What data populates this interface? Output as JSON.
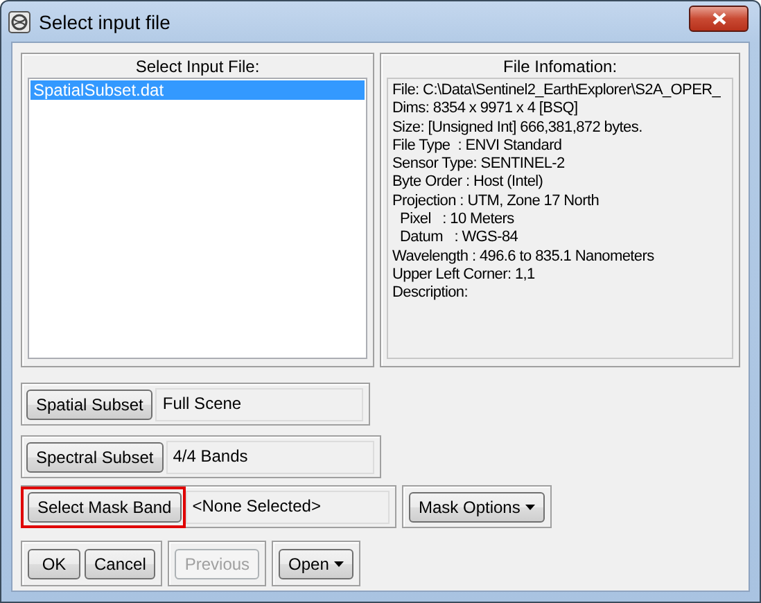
{
  "window": {
    "title": "Select input file"
  },
  "input_files": {
    "label": "Select Input File:",
    "files": [
      {
        "name": "SpatialSubset.dat",
        "selected": true
      }
    ]
  },
  "file_information": {
    "label": "File Infomation:",
    "lines": [
      "File: C:\\Data\\Sentinel2_EarthExplorer\\S2A_OPER_",
      "Dims: 8354 x 9971 x 4 [BSQ]",
      "Size: [Unsigned Int] 666,381,872 bytes.",
      "File Type  : ENVI Standard",
      "Sensor Type: SENTINEL-2",
      "Byte Order : Host (Intel)",
      "Projection : UTM, Zone 17 North",
      "  Pixel   : 10 Meters",
      "  Datum   : WGS-84",
      "Wavelength : 496.6 to 835.1 Nanometers",
      "Upper Left Corner: 1,1",
      "Description:"
    ]
  },
  "subsets": [
    {
      "button": "Spatial Subset",
      "value": "Full Scene",
      "highlighted": false
    },
    {
      "button": "Spectral Subset",
      "value": "4/4 Bands",
      "highlighted": false
    },
    {
      "button": "Select Mask Band",
      "value": "<None Selected>",
      "highlighted": true
    }
  ],
  "mask_options": {
    "label": "Mask Options"
  },
  "footer_groups": [
    {
      "buttons": [
        {
          "label": "OK",
          "disabled": false,
          "dropdown": false
        },
        {
          "label": "Cancel",
          "disabled": false,
          "dropdown": false
        }
      ]
    },
    {
      "buttons": [
        {
          "label": "Previous",
          "disabled": true,
          "dropdown": false
        }
      ]
    },
    {
      "buttons": [
        {
          "label": "Open",
          "disabled": false,
          "dropdown": true
        }
      ]
    }
  ]
}
